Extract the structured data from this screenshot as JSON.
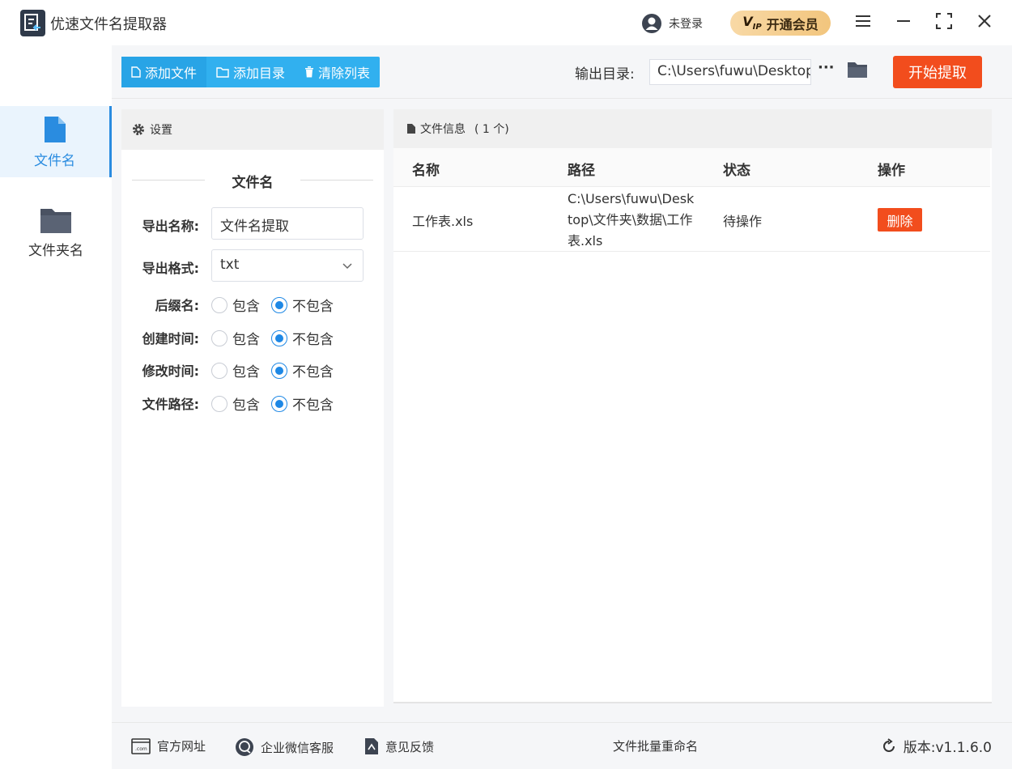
{
  "app": {
    "title": "优速文件名提取器",
    "login_text": "未登录",
    "vip_label": "开通会员",
    "vip_badge": "VIP"
  },
  "sidebar": {
    "items": [
      {
        "label": "文件名",
        "active": true
      },
      {
        "label": "文件夹名",
        "active": false
      }
    ]
  },
  "toolbar": {
    "add_file": "添加文件",
    "add_dir": "添加目录",
    "clear_list": "清除列表",
    "output_label": "输出目录:",
    "output_path": "C:\\Users\\fuwu\\Desktop",
    "more": "···",
    "start": "开始提取"
  },
  "settings": {
    "header": "设置",
    "section": "文件名",
    "export_name_label": "导出名称:",
    "export_name_value": "文件名提取",
    "export_format_label": "导出格式:",
    "export_format_value": "txt",
    "include": "包含",
    "exclude": "不包含",
    "options": [
      {
        "label": "后缀名:",
        "selected": "exclude"
      },
      {
        "label": "创建时间:",
        "selected": "exclude"
      },
      {
        "label": "修改时间:",
        "selected": "exclude"
      },
      {
        "label": "文件路径:",
        "selected": "exclude"
      }
    ]
  },
  "files": {
    "header": "文件信息",
    "count": "( 1 个)",
    "columns": {
      "name": "名称",
      "path": "路径",
      "status": "状态",
      "action": "操作"
    },
    "rows": [
      {
        "name": "工作表.xls",
        "path": "C:\\Users\\fuwu\\Desktop\\文件夹\\数据\\工作表.xls",
        "status": "待操作",
        "action": "删除"
      }
    ]
  },
  "footer": {
    "website": "官方网址",
    "wechat": "企业微信客服",
    "feedback": "意见反馈",
    "rename": "文件批量重命名",
    "version": "版本:v1.1.6.0"
  },
  "colors": {
    "accent": "#2a8ce0",
    "toolbar_blue": "#31b0ef",
    "danger": "#f24d1d",
    "vip_gold": "#f2c57d"
  }
}
